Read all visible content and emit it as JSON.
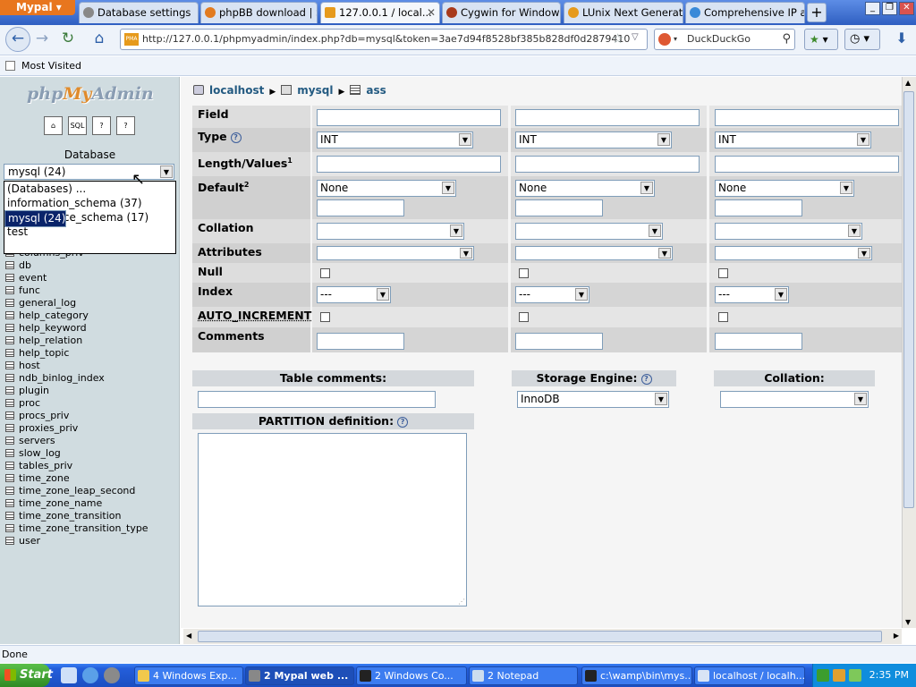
{
  "browser": {
    "app_menu": "Mypal",
    "tabs": [
      {
        "title": "Database settings",
        "icon_color": "#888888",
        "active": false
      },
      {
        "title": "phpBB download | S...",
        "icon_color": "#e27b20",
        "active": false
      },
      {
        "title": "127.0.0.1 / local...",
        "icon_color": "#e69a1c",
        "active": true
      },
      {
        "title": "Cygwin for Windows...",
        "icon_color": "#a83a1c",
        "active": false
      },
      {
        "title": "LUnix Next Generati...",
        "icon_color": "#e69a1c",
        "active": false
      },
      {
        "title": "Comprehensive IP a...",
        "icon_color": "#3a8ad8",
        "active": false
      }
    ],
    "new_tab": "+",
    "url": "http://127.0.0.1/phpmyadmin/index.php?db=mysql&token=3ae7d94f8528bf385b828df0d2879410",
    "url_favicon": "PMA",
    "search_engine": "DuckDuckGo",
    "bookmarks": {
      "most_visited": "Most Visited"
    },
    "status": "Done"
  },
  "left": {
    "logo_php": "php",
    "logo_my": "My",
    "logo_admin": "Admin",
    "database_label": "Database",
    "selected_db": "mysql (24)",
    "dropdown_options": [
      {
        "label": "(Databases) ...",
        "selected": false
      },
      {
        "label": "information_schema (37)",
        "selected": false
      },
      {
        "label": "mysql (24)",
        "selected": true
      },
      {
        "label": "performance_schema (17)",
        "selected": false
      },
      {
        "label": "test",
        "selected": false
      }
    ],
    "tables": [
      "columns_priv",
      "db",
      "event",
      "func",
      "general_log",
      "help_category",
      "help_keyword",
      "help_relation",
      "help_topic",
      "host",
      "ndb_binlog_index",
      "plugin",
      "proc",
      "procs_priv",
      "proxies_priv",
      "servers",
      "slow_log",
      "tables_priv",
      "time_zone",
      "time_zone_leap_second",
      "time_zone_name",
      "time_zone_transition",
      "time_zone_transition_type",
      "user"
    ]
  },
  "main": {
    "breadcrumb": {
      "server": "localhost",
      "database": "mysql",
      "table": "ass"
    },
    "labels": {
      "field": "Field",
      "type": "Type",
      "length": "Length/Values",
      "length_sup": "1",
      "default": "Default",
      "default_sup": "2",
      "collation": "Collation",
      "attributes": "Attributes",
      "null": "Null",
      "index": "Index",
      "auto_increment": "AUTO_INCREMENT",
      "comments": "Comments"
    },
    "columns": [
      {
        "field": "",
        "type": "INT",
        "length": "",
        "default": "None",
        "default_value": "",
        "collation": "",
        "attributes": "",
        "null": false,
        "index": "---",
        "auto_increment": false,
        "comments": ""
      },
      {
        "field": "",
        "type": "INT",
        "length": "",
        "default": "None",
        "default_value": "",
        "collation": "",
        "attributes": "",
        "null": false,
        "index": "---",
        "auto_increment": false,
        "comments": ""
      },
      {
        "field": "",
        "type": "INT",
        "length": "",
        "default": "None",
        "default_value": "",
        "collation": "",
        "attributes": "",
        "null": false,
        "index": "---",
        "auto_increment": false,
        "comments": ""
      }
    ],
    "table_comments_label": "Table comments:",
    "table_comments_value": "",
    "storage_engine_label": "Storage Engine:",
    "storage_engine_value": "InnoDB",
    "collation_label": "Collation:",
    "collation_value": "",
    "partition_label": "PARTITION definition:",
    "partition_value": ""
  },
  "taskbar": {
    "start": "Start",
    "tasks": [
      {
        "label": "4 Windows Exp...",
        "active": false
      },
      {
        "label": "2 Mypal web ...",
        "active": true
      },
      {
        "label": "2 Windows Co...",
        "active": false
      },
      {
        "label": "2 Notepad",
        "active": false
      },
      {
        "label": "c:\\wamp\\bin\\mys...",
        "active": false
      },
      {
        "label": "localhost / localh...",
        "active": false
      }
    ],
    "clock": "2:35 PM"
  }
}
